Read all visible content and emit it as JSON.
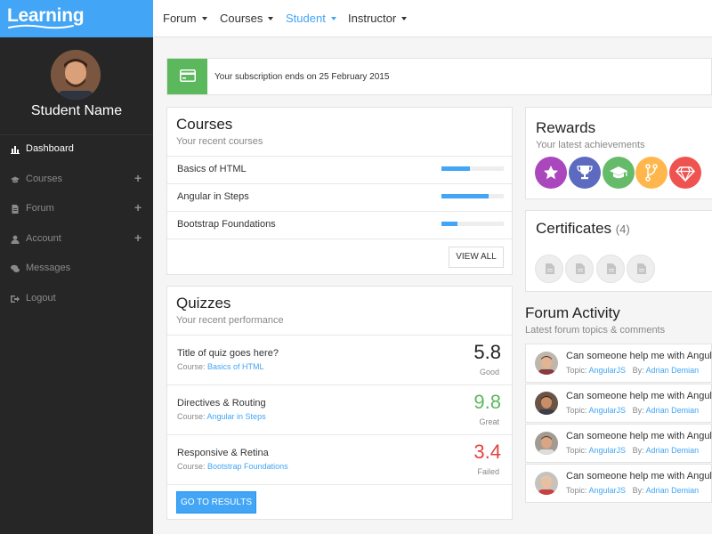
{
  "brand": {
    "name": "Learning"
  },
  "topnav": {
    "items": [
      {
        "label": "Forum"
      },
      {
        "label": "Courses"
      },
      {
        "label": "Student"
      },
      {
        "label": "Instructor"
      }
    ]
  },
  "sidebar": {
    "student_name": "Student Name",
    "items": [
      {
        "label": "Dashboard",
        "icon": "bar-chart-icon"
      },
      {
        "label": "Courses",
        "icon": "graduation-cap-icon"
      },
      {
        "label": "Forum",
        "icon": "document-icon"
      },
      {
        "label": "Account",
        "icon": "user-icon"
      },
      {
        "label": "Messages",
        "icon": "chat-icon"
      },
      {
        "label": "Logout",
        "icon": "sign-out-icon"
      }
    ]
  },
  "alert": {
    "text": "Your subscription ends on 25 February 2015",
    "color": "#5cb85c"
  },
  "courses": {
    "title": "Courses",
    "subtitle": "Your recent courses",
    "items": [
      {
        "name": "Basics of HTML",
        "progress": 0.45
      },
      {
        "name": "Angular in Steps",
        "progress": 0.75
      },
      {
        "name": "Bootstrap Foundations",
        "progress": 0.25
      }
    ],
    "view_all": "VIEW ALL"
  },
  "quizzes": {
    "title": "Quizzes",
    "subtitle": "Your recent performance",
    "course_prefix": "Course:",
    "items": [
      {
        "title": "Title of quiz goes here?",
        "course": "Basics of HTML",
        "score": "5.8",
        "status": "Good",
        "color": "#222222"
      },
      {
        "title": "Directives & Routing",
        "course": "Angular in Steps",
        "score": "9.8",
        "status": "Great",
        "color": "#5cb85c"
      },
      {
        "title": "Responsive & Retina",
        "course": "Bootstrap Foundations",
        "score": "3.4",
        "status": "Failed",
        "color": "#e0443e"
      }
    ],
    "results_button": "GO TO RESULTS"
  },
  "rewards": {
    "title": "Rewards",
    "subtitle": "Your latest achievements",
    "badges": [
      {
        "icon": "star-icon",
        "color": "#ab47bc"
      },
      {
        "icon": "trophy-icon",
        "color": "#5c6bc0"
      },
      {
        "icon": "graduation-cap-icon",
        "color": "#66bb6a"
      },
      {
        "icon": "code-fork-icon",
        "color": "#ffb74d"
      },
      {
        "icon": "diamond-icon",
        "color": "#ef5350"
      }
    ]
  },
  "certificates": {
    "title": "Certificates",
    "count": "(4)"
  },
  "forum_activity": {
    "title": "Forum Activity",
    "subtitle": "Latest forum topics & comments",
    "topic_prefix": "Topic:",
    "by_prefix": "By:",
    "items": [
      {
        "title": "Can someone help me with AngularJS",
        "topic": "AngularJS",
        "author": "Adrian Demian"
      },
      {
        "title": "Can someone help me with AngularJS",
        "topic": "AngularJS",
        "author": "Adrian Demian"
      },
      {
        "title": "Can someone help me with AngularJS",
        "topic": "AngularJS",
        "author": "Adrian Demian"
      },
      {
        "title": "Can someone help me with AngularJS",
        "topic": "AngularJS",
        "author": "Adrian Demian"
      }
    ]
  },
  "colors": {
    "accent": "#42a5f5",
    "sidebar": "#262626"
  }
}
